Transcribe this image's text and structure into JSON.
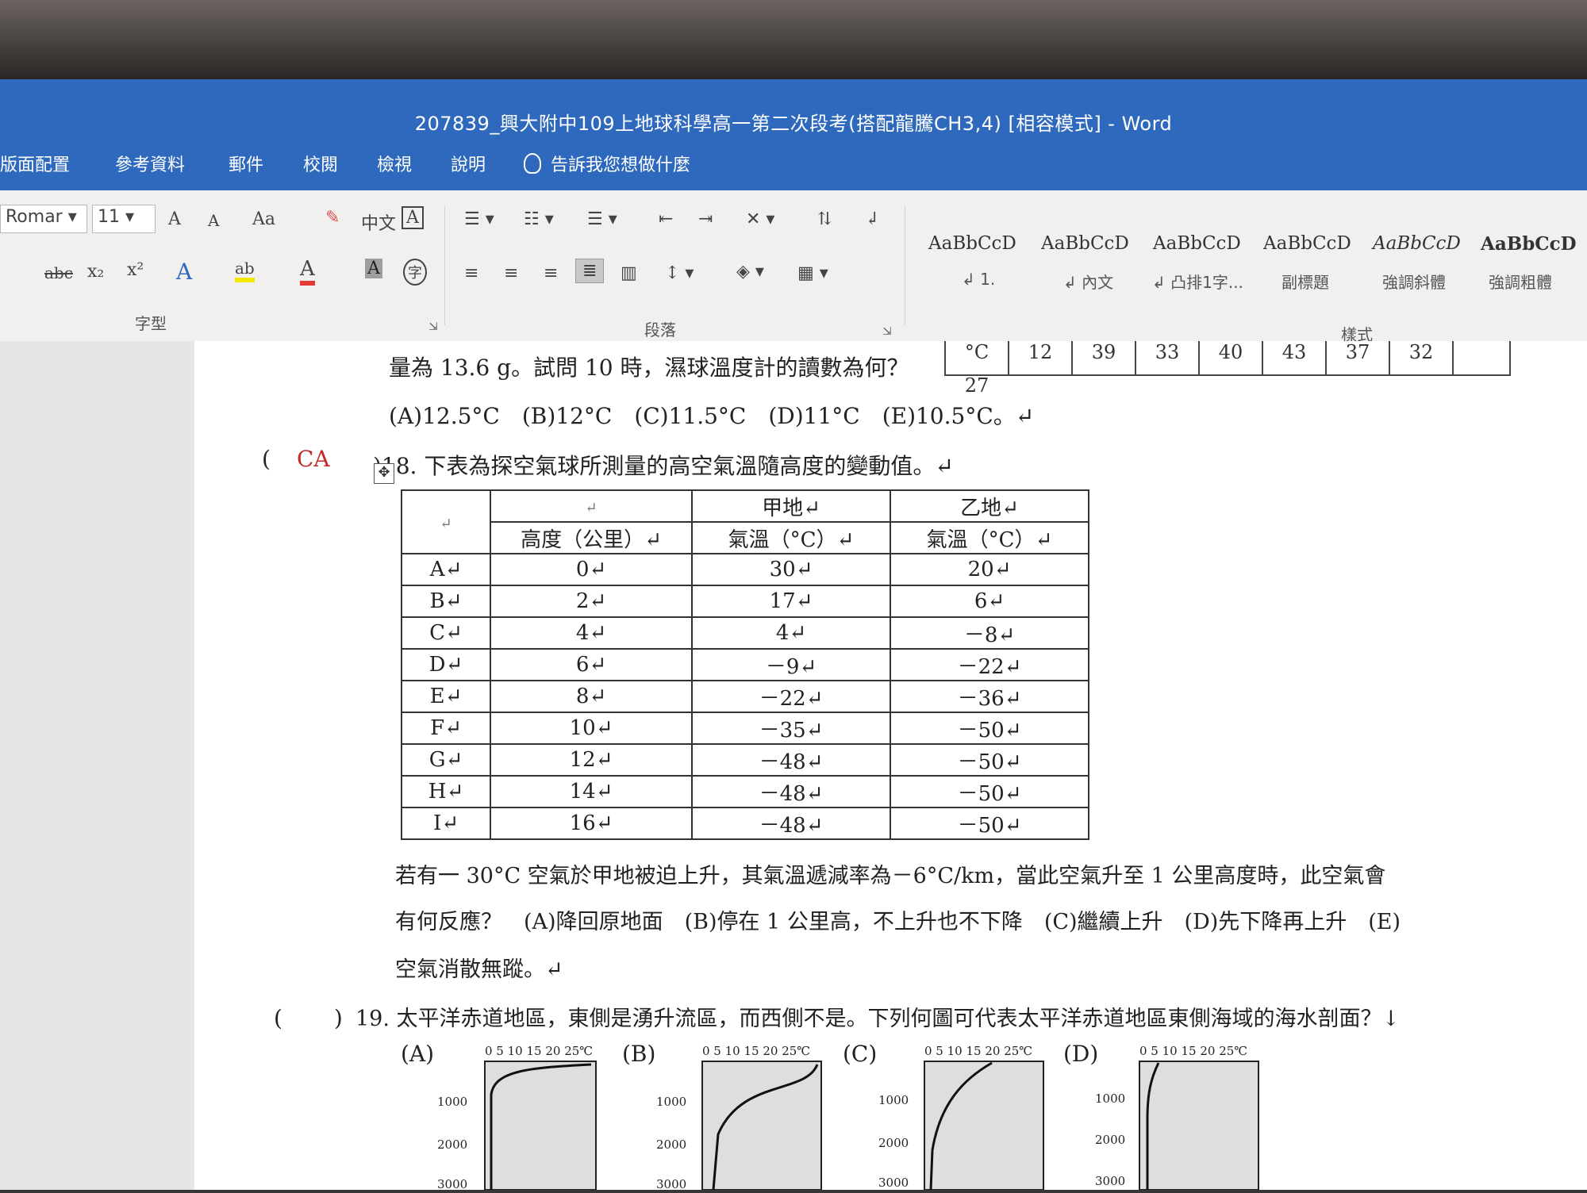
{
  "window": {
    "title": "207839_興大附中109上地球科學高一第二次段考(搭配龍騰CH3,4) [相容模式]  -  Word"
  },
  "menu": {
    "items": [
      "版面配置",
      "參考資料",
      "郵件",
      "校閱",
      "檢視",
      "說明"
    ],
    "tell_me": "告訴我您想做什麼"
  },
  "ribbon": {
    "font_name": "Romar",
    "font_size": "11",
    "font_group_label": "字型",
    "paragraph_group_label": "段落",
    "styles_group_label": "樣式",
    "styles": [
      {
        "sample": "AaBbCcD",
        "name": "↲ 1."
      },
      {
        "sample": "AaBbCcD",
        "name": "↲ 內文"
      },
      {
        "sample": "AaBbCcD",
        "name": "↲ 凸排1字..."
      },
      {
        "sample": "AaBbCcD",
        "name": "副標題"
      },
      {
        "sample": "AaBbCcD",
        "name": "強調斜體"
      },
      {
        "sample": "AaBbCcD",
        "name": "強調粗體"
      }
    ],
    "glyphs": {
      "grow_font": "A",
      "shrink_font": "A",
      "change_case": "Aa",
      "strikethrough": "abc",
      "subscript": "x₂",
      "superscript": "x²",
      "text_effects": "A",
      "highlight": "ab",
      "font_color": "A",
      "char_shading": "A",
      "enclose": "字",
      "phonetic": "中文",
      "char_border": "A"
    }
  },
  "doc": {
    "top_table_partial": [
      "°C",
      "12",
      "39",
      "33",
      "40",
      "43",
      "37",
      "32",
      "27"
    ],
    "line1": "量為 13.6 g。試問 10 時，濕球溫度計的讀數為何？",
    "line2": "(A)12.5°C　(B)12°C　(C)11.5°C　(D)11°C　(E)10.5°C。↵",
    "q18": {
      "paren_open": "(",
      "answer": "CA",
      "text": ")18.  下表為探空氣球所測量的高空氣溫隨高度的變動值。↵",
      "table": {
        "header1": [
          "↵",
          "↵",
          "甲地↵",
          "乙地↵"
        ],
        "header2": [
          "高度（公里）↵",
          "氣溫（°C）↵",
          "氣溫（°C）↵"
        ],
        "rows": [
          [
            "A↵",
            "0↵",
            "30↵",
            "20↵"
          ],
          [
            "B↵",
            "2↵",
            "17↵",
            "6↵"
          ],
          [
            "C↵",
            "4↵",
            "4↵",
            "－8↵"
          ],
          [
            "D↵",
            "6↵",
            "－9↵",
            "－22↵"
          ],
          [
            "E↵",
            "8↵",
            "－22↵",
            "－36↵"
          ],
          [
            "F↵",
            "10↵",
            "－35↵",
            "－50↵"
          ],
          [
            "G↵",
            "12↵",
            "－48↵",
            "－50↵"
          ],
          [
            "H↵",
            "14↵",
            "－48↵",
            "－50↵"
          ],
          [
            "I↵",
            "16↵",
            "－48↵",
            "－50↵"
          ]
        ]
      },
      "follow1": "若有一 30°C 空氣於甲地被迫上升，其氣溫遞減率為－6°C/km，當此空氣升至 1 公里高度時，此空氣會",
      "follow2": "有何反應？　(A)降回原地面　(B)停在 1 公里高，不上升也不下降　(C)繼續上升　(D)先下降再上升　(E)",
      "follow3": "空氣消散無蹤。↵"
    },
    "q19": {
      "paren": "(　　 )",
      "text": "19. 太平洋赤道地區，東側是湧升流區，而西側不是。下列何圖可代表太平洋赤道地區東側海域的海水剖面？↓",
      "options": [
        "(A)",
        "(B)",
        "(C)",
        "(D)"
      ],
      "axis_top": "0  5  10 15 20 25℃",
      "depth_ticks": [
        "1000",
        "2000",
        "3000"
      ]
    }
  }
}
